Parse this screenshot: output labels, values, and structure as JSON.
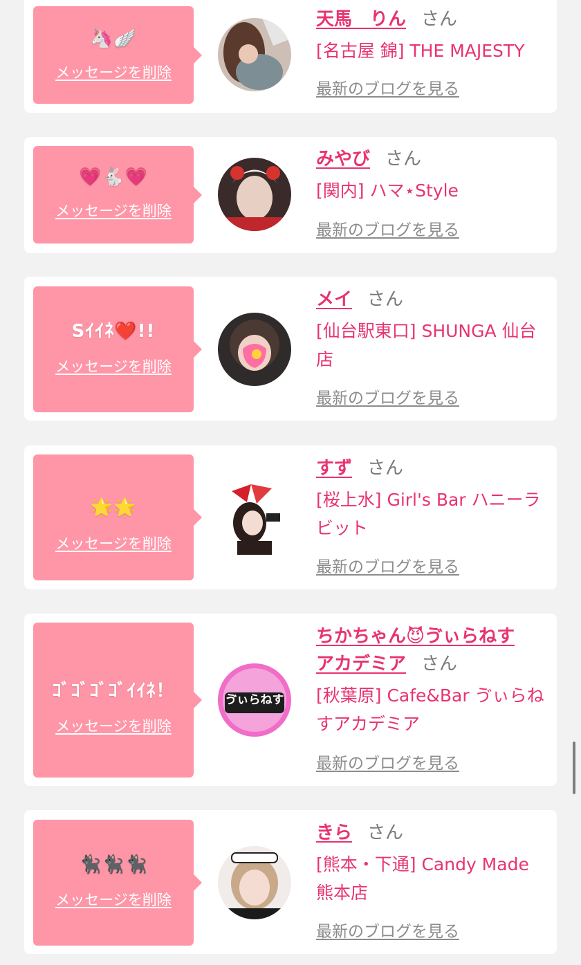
{
  "common": {
    "delete_label": "メッセージを削除",
    "san": "さん",
    "blog_label": "最新のブログを見る"
  },
  "colors": {
    "background": "#f2f2f2",
    "card": "#ffffff",
    "bubble": "#ff96a8",
    "accent": "#e8336f",
    "muted": "#8c8c8c"
  },
  "items": [
    {
      "message": "🦄🪽",
      "name": "天馬　りん",
      "shop": "[名古屋 錦] THE MAJESTY",
      "avatar_icon": "avatar-photo"
    },
    {
      "message": "💗🐇💗",
      "name": "みやび",
      "shop": "[関内] ハマ⋆Style",
      "avatar_icon": "avatar-photo"
    },
    {
      "message": "Sｲｲﾈ❤️!!",
      "name": "メイ",
      "shop": "[仙台駅東口] SHUNGA 仙台店",
      "avatar_icon": "avatar-photo"
    },
    {
      "message": "🌟🌟",
      "name": "すず",
      "shop": "[桜上水] Girl's Bar ハニーラビット",
      "avatar_icon": "avatar-photo"
    },
    {
      "message": "ｺﾞｺﾞｺﾞｺﾞｲｲﾈ！",
      "name_line1": "ちかちゃん😈ゔぃらねす",
      "name_line2": "アカデミア",
      "shop": "[秋葉原] Cafe&Bar ゔぃらねすアカデミア",
      "avatar_text": "ゔぃらねす",
      "avatar_icon": "shop-logo"
    },
    {
      "message": "🐈‍⬛🐈‍⬛🐈‍⬛",
      "name": "きら",
      "shop": "[熊本・下通] Candy Made 熊本店",
      "avatar_icon": "avatar-photo"
    }
  ]
}
